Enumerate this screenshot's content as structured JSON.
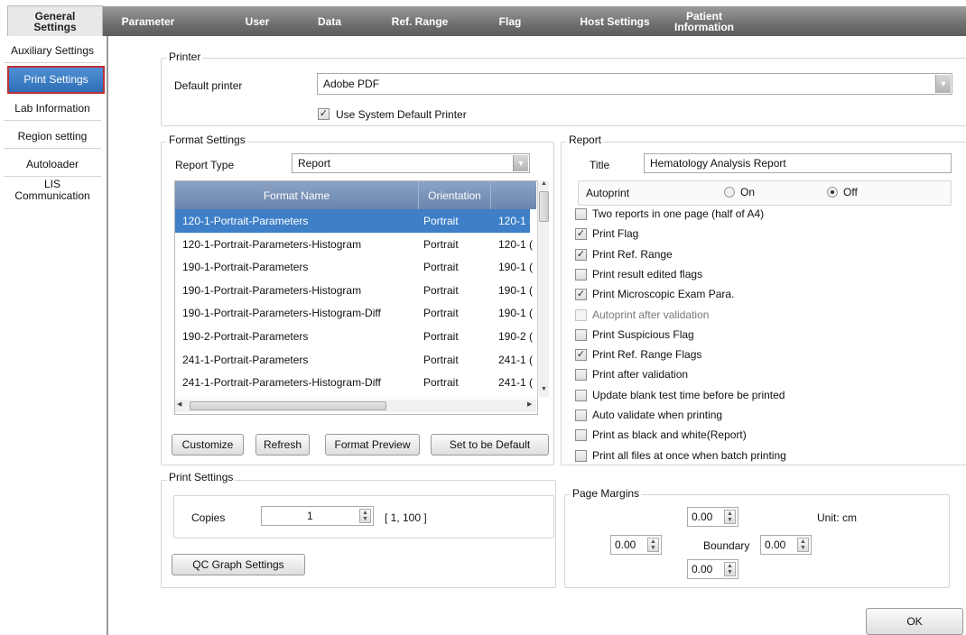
{
  "top_tabs": [
    "General\nSettings",
    "Parameter",
    "User",
    "Data",
    "Ref. Range",
    "Flag",
    "Host Settings",
    "Patient\nInformation"
  ],
  "left_nav": [
    "Auxiliary Settings",
    "Print Settings",
    "Lab Information",
    "Region setting",
    "Autoloader",
    "LIS\nCommunication"
  ],
  "printer": {
    "group_label": "Printer",
    "default_label": "Default printer",
    "default_value": "Adobe PDF",
    "use_system_label": "Use System Default Printer",
    "use_system_checked": true
  },
  "format": {
    "group_label": "Format Settings",
    "report_type_label": "Report Type",
    "report_type_value": "Report",
    "columns": [
      "Format Name",
      "Orientation",
      ""
    ],
    "rows": [
      [
        "120-1-Portrait-Parameters",
        "Portrait",
        "120-1 ("
      ],
      [
        "120-1-Portrait-Parameters-Histogram",
        "Portrait",
        "120-1 ("
      ],
      [
        "190-1-Portrait-Parameters",
        "Portrait",
        "190-1 ("
      ],
      [
        "190-1-Portrait-Parameters-Histogram",
        "Portrait",
        "190-1 ("
      ],
      [
        "190-1-Portrait-Parameters-Histogram-Diff",
        "Portrait",
        "190-1 ("
      ],
      [
        "190-2-Portrait-Parameters",
        "Portrait",
        "190-2 ("
      ],
      [
        "241-1-Portrait-Parameters",
        "Portrait",
        "241-1 ("
      ],
      [
        "241-1-Portrait-Parameters-Histogram-Diff",
        "Portrait",
        "241-1 ("
      ]
    ],
    "buttons": [
      "Customize",
      "Refresh",
      "Format Preview",
      "Set to be Default"
    ]
  },
  "report": {
    "group_label": "Report",
    "title_label": "Title",
    "title_value": "Hematology Analysis Report",
    "autoprint_label": "Autoprint",
    "on_label": "On",
    "off_label": "Off",
    "autoprint_on": false,
    "options": [
      {
        "label": "Two reports in one page (half of A4)",
        "checked": false,
        "enabled": true
      },
      {
        "label": "Print Flag",
        "checked": true,
        "enabled": true
      },
      {
        "label": "Print Ref. Range",
        "checked": true,
        "enabled": true
      },
      {
        "label": "Print result edited flags",
        "checked": false,
        "enabled": true
      },
      {
        "label": "Print Microscopic Exam Para.",
        "checked": true,
        "enabled": true
      },
      {
        "label": "Autoprint after validation",
        "checked": false,
        "enabled": false
      },
      {
        "label": "Print Suspicious Flag",
        "checked": false,
        "enabled": true
      },
      {
        "label": "Print Ref. Range Flags",
        "checked": true,
        "enabled": true
      },
      {
        "label": "Print after validation",
        "checked": false,
        "enabled": true
      },
      {
        "label": "Update blank test time before be printed",
        "checked": false,
        "enabled": true
      },
      {
        "label": "Auto validate when printing",
        "checked": false,
        "enabled": true
      },
      {
        "label": "Print as black and white(Report)",
        "checked": false,
        "enabled": true
      },
      {
        "label": "Print all files at once when batch printing",
        "checked": false,
        "enabled": true
      }
    ]
  },
  "print_settings": {
    "group_label": "Print Settings",
    "copies_label": "Copies",
    "copies_value": "1",
    "copies_range": "[ 1, 100 ]",
    "qc_button": "QC Graph Settings"
  },
  "margins": {
    "group_label": "Page Margins",
    "top": "0.00",
    "left": "0.00",
    "right": "0.00",
    "bottom": "0.00",
    "boundary_label": "Boundary",
    "unit_label": "Unit: cm"
  },
  "ok_button": "OK",
  "colors": {
    "selection": "#3e7fc8",
    "header": "#6b85ad",
    "accent_border": "#c0303a"
  }
}
